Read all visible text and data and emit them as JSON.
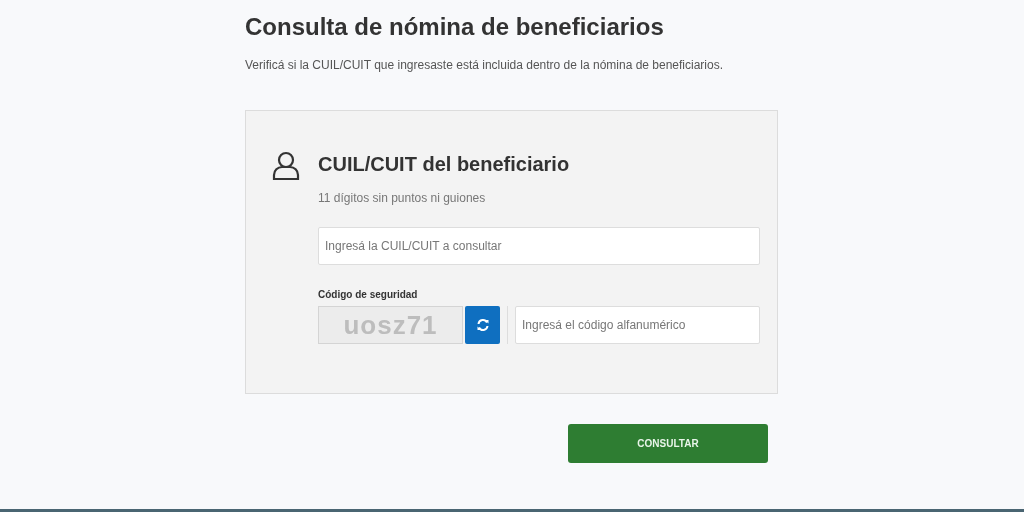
{
  "page": {
    "title": "Consulta de nómina de beneficiarios",
    "subtitle": "Verificá si la CUIL/CUIT que ingresaste está incluida dentro de la nómina de beneficiarios."
  },
  "form": {
    "heading": "CUIL/CUIT del beneficiario",
    "hint": "11 dígitos sin puntos ni guiones",
    "cuil_field": {
      "placeholder": "Ingresá la CUIL/CUIT a consultar"
    },
    "security_label": "Código de seguridad",
    "captcha": "uosz71",
    "code_field": {
      "placeholder": "Ingresá el código alfanumérico"
    }
  },
  "submit_button": "CONSULTAR"
}
